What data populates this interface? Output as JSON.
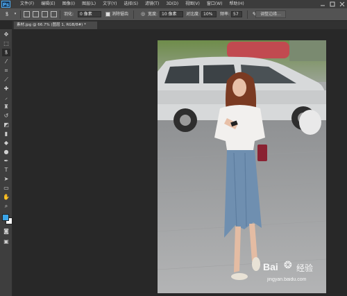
{
  "app": {
    "logo": "Ps"
  },
  "menu": [
    "文件(F)",
    "编辑(E)",
    "图像(I)",
    "图层(L)",
    "文字(Y)",
    "选择(S)",
    "滤镜(T)",
    "3D(D)",
    "视图(V)",
    "窗口(W)",
    "帮助(H)"
  ],
  "options": {
    "feather_label": "羽化:",
    "feather_value": "0 像素",
    "antialias_label": "消除锯齿",
    "width_label": "宽度:",
    "width_value": "10 像素",
    "contrast_label": "对比度:",
    "contrast_value": "10%",
    "frequency_label": "频率:",
    "frequency_value": "57",
    "refine_edge_label": "调整边缘..."
  },
  "document": {
    "tab_title": "素材.jpg @ 66.7% (图层 1, RGB/8#) *"
  },
  "watermark": {
    "brand": "Bai",
    "brand_suffix": "经验",
    "url": "jingyan.baidu.com"
  },
  "icons": [
    "lasso-icon",
    "move-icon",
    "marquee-icon",
    "magic-wand-icon",
    "crop-icon",
    "eyedropper-icon",
    "healing-brush-icon",
    "brush-icon",
    "clone-stamp-icon",
    "history-brush-icon",
    "eraser-icon",
    "gradient-icon",
    "blur-icon",
    "dodge-icon",
    "pen-icon",
    "type-icon",
    "path-selection-icon",
    "shape-icon",
    "hand-icon",
    "zoom-icon",
    "color-swatches-icon",
    "quick-mask-icon",
    "screen-mode-icon"
  ]
}
